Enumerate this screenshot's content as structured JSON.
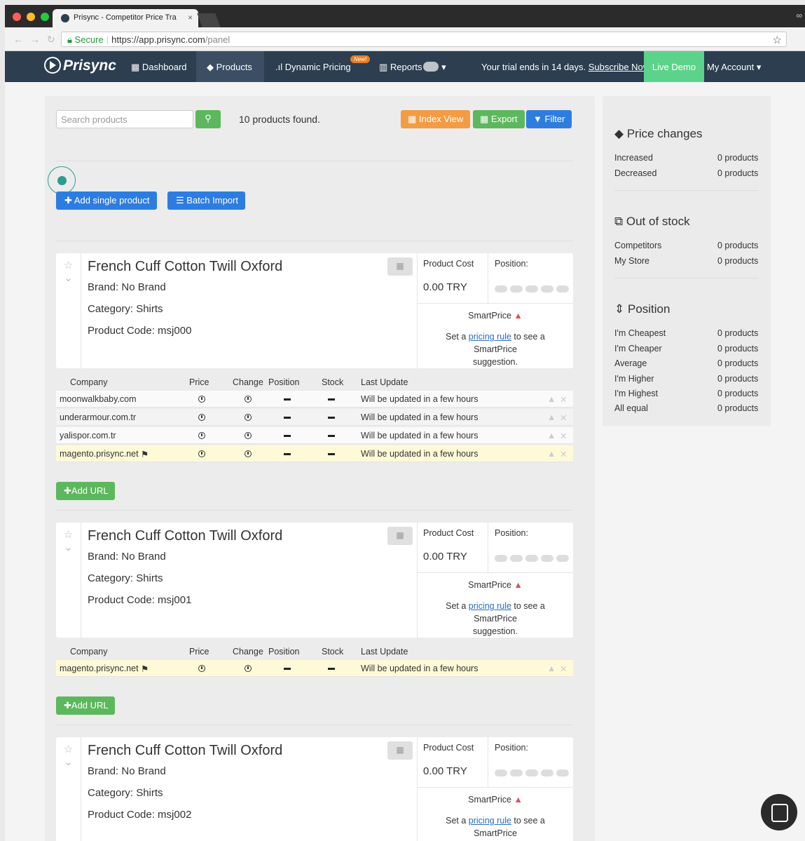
{
  "browser": {
    "tab_title": "Prisync - Competitor Price Tra",
    "secure_label": "Secure",
    "url_host": "https://app.prisync.com",
    "url_path": "/panel"
  },
  "nav": {
    "logo": "Prisync",
    "dashboard": "Dashboard",
    "products": "Products",
    "dynamic_pricing": "Dynamic Pricing",
    "new_badge": "New!",
    "reports": "Reports",
    "trial_text": "Your trial ends in 14 days.",
    "subscribe": "Subscribe Now!",
    "live_demo": "Live Demo",
    "my_account": "My Account"
  },
  "toolbar": {
    "search_placeholder": "Search products",
    "found": "10 products found.",
    "index_view": "Index View",
    "export": "Export",
    "filter": "Filter",
    "add_single": "Add single product",
    "batch_import": "Batch Import"
  },
  "labels": {
    "product_cost": "Product Cost",
    "position": "Position:",
    "smartprice": "SmartPrice",
    "set_a": "Set a",
    "pricing_rule": "pricing rule",
    "see_suggestion": "to see a SmartPrice",
    "suggestion": "suggestion.",
    "add_url": "Add URL",
    "col_company": "Company",
    "col_price": "Price",
    "col_change": "Change",
    "col_position": "Position",
    "col_stock": "Stock",
    "col_update": "Last Update"
  },
  "products": [
    {
      "name": "French Cuff Cotton Twill Oxford",
      "brand": "Brand: No Brand",
      "category": "Category: Shirts",
      "code": "Product Code: msj000",
      "cost": "0.00 TRY",
      "rows": [
        {
          "company": "moonwalkbaby.com",
          "update": "Will be updated in a few hours"
        },
        {
          "company": "underarmour.com.tr",
          "update": "Will be updated in a few hours"
        },
        {
          "company": "yalispor.com.tr",
          "update": "Will be updated in a few hours"
        },
        {
          "company": "magento.prisync.net",
          "update": "Will be updated in a few hours"
        }
      ]
    },
    {
      "name": "French Cuff Cotton Twill Oxford",
      "brand": "Brand: No Brand",
      "category": "Category: Shirts",
      "code": "Product Code: msj001",
      "cost": "0.00 TRY",
      "rows": [
        {
          "company": "magento.prisync.net",
          "update": "Will be updated in a few hours"
        }
      ]
    },
    {
      "name": "French Cuff Cotton Twill Oxford",
      "brand": "Brand: No Brand",
      "category": "Category: Shirts",
      "code": "Product Code: msj002",
      "cost": "0.00 TRY"
    }
  ],
  "sidebar": {
    "price_changes": "Price changes",
    "increased": "Increased",
    "decreased": "Decreased",
    "out_of_stock": "Out of stock",
    "competitors": "Competitors",
    "my_store": "My Store",
    "position": "Position",
    "cheapest": "I'm Cheapest",
    "cheaper": "I'm Cheaper",
    "average": "Average",
    "higher": "I'm Higher",
    "highest": "I'm Highest",
    "all_equal": "All equal",
    "zero": "0 products"
  },
  "colors": {
    "navbar": "#2c3e50",
    "live_demo": "#5cd38a",
    "primary": "#2d7de0",
    "success": "#5cb85c",
    "warning": "#f39c43"
  }
}
